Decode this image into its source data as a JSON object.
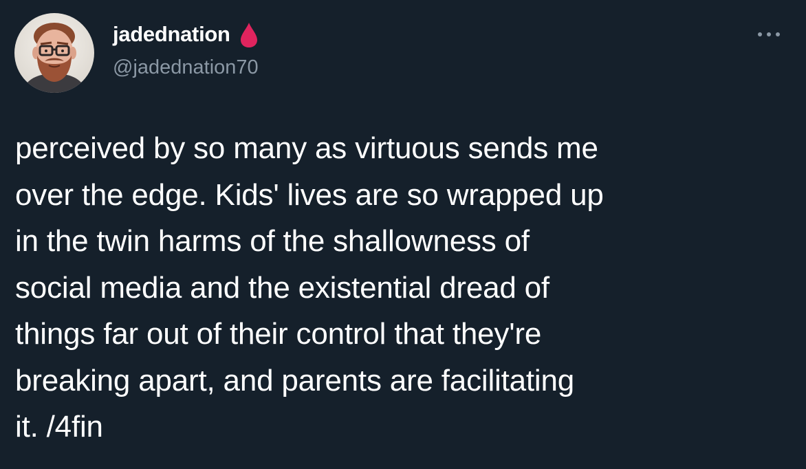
{
  "author": {
    "display_name": "jadednation",
    "handle": "@jadednation70",
    "badge_icon": "blood-drop-icon",
    "badge_color": "#e0245e"
  },
  "menu": {
    "icon": "more-horizontal-icon"
  },
  "tweet": {
    "text": "perceived by so many as virtuous sends me\nover the edge. Kids' lives are so wrapped up\nin the twin harms of the shallowness of\nsocial media and the existential dread of\nthings far out of their control that they're\nbreaking apart, and parents are facilitating\nit. /4fin"
  },
  "colors": {
    "background": "#15202b",
    "text_primary": "#ffffff",
    "text_secondary": "#8b98a5"
  }
}
